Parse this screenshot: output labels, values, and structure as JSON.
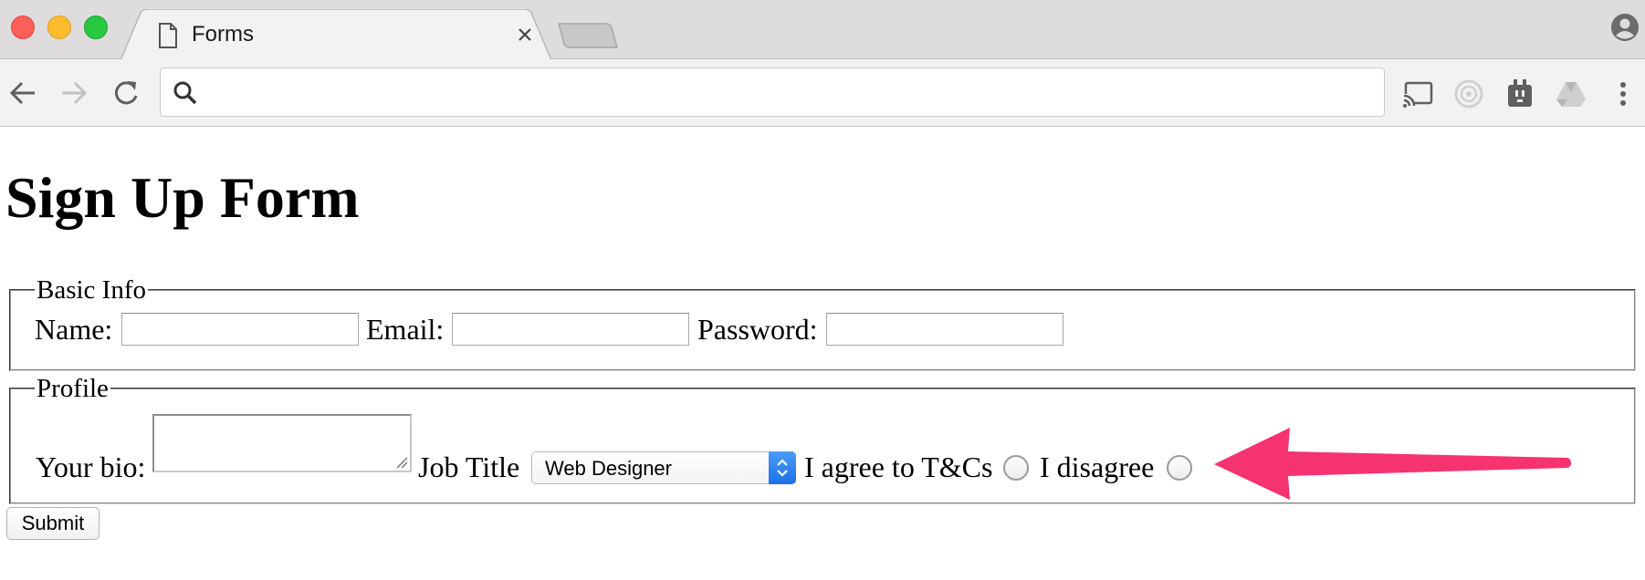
{
  "browser": {
    "tab": {
      "title": "Forms",
      "icon": "document-icon"
    },
    "omnibox": {
      "value": "",
      "placeholder": ""
    },
    "toolbar_icons": [
      "back-icon",
      "forward-icon",
      "reload-icon",
      "search-icon",
      "cast-icon",
      "timer-icon",
      "plug-extension-icon",
      "drive-icon",
      "menu-icon",
      "profile-icon"
    ]
  },
  "page": {
    "title": "Sign Up Form",
    "basic_info": {
      "legend": "Basic Info",
      "name_label": "Name:",
      "email_label": "Email:",
      "password_label": "Password:",
      "name_value": "",
      "email_value": "",
      "password_value": ""
    },
    "profile": {
      "legend": "Profile",
      "bio_label": "Your bio:",
      "bio_value": "",
      "job_title_label": "Job Title",
      "job_title_selected": "Web Designer",
      "agree_label": "I agree to T&Cs",
      "disagree_label": "I disagree"
    },
    "submit_label": "Submit"
  },
  "annotation": {
    "arrow_color": "#f53370",
    "points_to": "radio-buttons"
  },
  "colors": {
    "select_accent": "#1b71e6",
    "tabstrip": "#dedcdd",
    "toolbar": "#f2f2f2"
  }
}
